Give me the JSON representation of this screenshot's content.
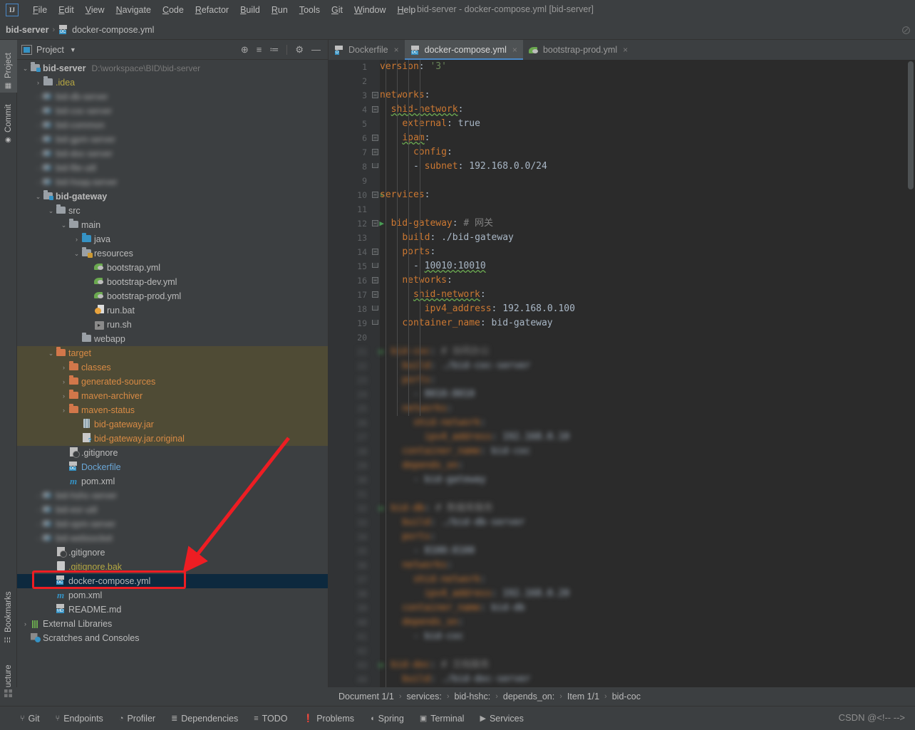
{
  "window": {
    "title": "bid-server - docker-compose.yml [bid-server]"
  },
  "menu": {
    "logo": "IJ",
    "items": [
      "File",
      "Edit",
      "View",
      "Navigate",
      "Code",
      "Refactor",
      "Build",
      "Run",
      "Tools",
      "Git",
      "Window",
      "Help"
    ]
  },
  "navbar": {
    "project": "bid-server",
    "file": "docker-compose.yml"
  },
  "left_strip": {
    "tabs": [
      {
        "label": "Project",
        "icon": "project-icon",
        "active": true
      },
      {
        "label": "Commit",
        "icon": "commit-icon",
        "active": false
      },
      {
        "label": "Bookmarks",
        "icon": "bookmark-icon",
        "active": false
      },
      {
        "label": "Structure",
        "icon": "structure-icon",
        "active": false
      }
    ]
  },
  "project_panel": {
    "title": "Project",
    "tools": [
      {
        "name": "select-opened-file-icon",
        "glyph": "⊕"
      },
      {
        "name": "expand-all-icon",
        "glyph": "≡"
      },
      {
        "name": "collapse-all-icon",
        "glyph": "≔"
      },
      {
        "name": "settings-gear-icon",
        "glyph": "⚙"
      },
      {
        "name": "hide-panel-icon",
        "glyph": "—"
      }
    ],
    "tree": [
      {
        "indent": 0,
        "arrow": "v",
        "icon": "module-folder",
        "label": "bid-server",
        "sub": "D:\\workspace\\BID\\bid-server",
        "bold": true
      },
      {
        "indent": 1,
        "arrow": ">",
        "icon": "folder-grey",
        "label": ".idea",
        "yellow": true
      },
      {
        "indent": 1,
        "arrow": ">",
        "icon": "module",
        "label": "bid-db-server",
        "blur": true
      },
      {
        "indent": 1,
        "arrow": ">",
        "icon": "module",
        "label": "bid-coc-server",
        "blur": true
      },
      {
        "indent": 1,
        "arrow": ">",
        "icon": "module",
        "label": "bid-common",
        "blur": true
      },
      {
        "indent": 1,
        "arrow": ">",
        "icon": "module",
        "label": "bid-gpm-server",
        "blur": true
      },
      {
        "indent": 1,
        "arrow": ">",
        "icon": "module",
        "label": "bid-doc-server",
        "blur": true
      },
      {
        "indent": 1,
        "arrow": ">",
        "icon": "module",
        "label": "bid-file-util",
        "blur": true
      },
      {
        "indent": 1,
        "arrow": ">",
        "icon": "module",
        "label": "bid-hsqq-server",
        "blur": true
      },
      {
        "indent": 1,
        "arrow": "v",
        "icon": "module-folder",
        "label": "bid-gateway",
        "bold": true
      },
      {
        "indent": 2,
        "arrow": "v",
        "icon": "folder-grey",
        "label": "src"
      },
      {
        "indent": 3,
        "arrow": "v",
        "icon": "folder-grey",
        "label": "main"
      },
      {
        "indent": 4,
        "arrow": ">",
        "icon": "folder-src",
        "label": "java"
      },
      {
        "indent": 4,
        "arrow": "v",
        "icon": "folder-res",
        "label": "resources"
      },
      {
        "indent": 5,
        "arrow": "",
        "icon": "yml",
        "label": "bootstrap.yml"
      },
      {
        "indent": 5,
        "arrow": "",
        "icon": "yml",
        "label": "bootstrap-dev.yml"
      },
      {
        "indent": 5,
        "arrow": "",
        "icon": "yml",
        "label": "bootstrap-prod.yml"
      },
      {
        "indent": 5,
        "arrow": "",
        "icon": "bat",
        "label": "run.bat"
      },
      {
        "indent": 5,
        "arrow": "",
        "icon": "sh",
        "label": "run.sh"
      },
      {
        "indent": 4,
        "arrow": "",
        "icon": "folder-grey",
        "label": "webapp"
      },
      {
        "indent": 2,
        "arrow": "v",
        "icon": "folder-orange",
        "label": "target",
        "excluded": true
      },
      {
        "indent": 3,
        "arrow": ">",
        "icon": "folder-orange",
        "label": "classes",
        "excluded": true
      },
      {
        "indent": 3,
        "arrow": ">",
        "icon": "folder-orange",
        "label": "generated-sources",
        "excluded": true
      },
      {
        "indent": 3,
        "arrow": ">",
        "icon": "folder-orange",
        "label": "maven-archiver",
        "excluded": true
      },
      {
        "indent": 3,
        "arrow": ">",
        "icon": "folder-orange",
        "label": "maven-status",
        "excluded": true
      },
      {
        "indent": 4,
        "arrow": "",
        "icon": "jar",
        "label": "bid-gateway.jar",
        "excluded": true
      },
      {
        "indent": 4,
        "arrow": "",
        "icon": "jar-original",
        "label": "bid-gateway.jar.original",
        "excluded": true
      },
      {
        "indent": 3,
        "arrow": "",
        "icon": "gitignore",
        "label": ".gitignore"
      },
      {
        "indent": 3,
        "arrow": "",
        "icon": "docker",
        "label": "Dockerfile",
        "blue": true
      },
      {
        "indent": 3,
        "arrow": "",
        "icon": "maven",
        "label": "pom.xml"
      },
      {
        "indent": 1,
        "arrow": ">",
        "icon": "module",
        "label": "bid-hshc-server",
        "blur": true
      },
      {
        "indent": 1,
        "arrow": ">",
        "icon": "module",
        "label": "bid-esr-util",
        "blur": true
      },
      {
        "indent": 1,
        "arrow": ">",
        "icon": "module",
        "label": "bid-opm-server",
        "blur": true
      },
      {
        "indent": 1,
        "arrow": ">",
        "icon": "module",
        "label": "bid-websocket",
        "blur": true
      },
      {
        "indent": 2,
        "arrow": "",
        "icon": "gitignore",
        "label": ".gitignore"
      },
      {
        "indent": 2,
        "arrow": "",
        "icon": "file",
        "label": ".gitignore.bak",
        "yellow": true
      },
      {
        "indent": 2,
        "arrow": "",
        "icon": "docker",
        "label": "docker-compose.yml",
        "selected": true
      },
      {
        "indent": 2,
        "arrow": "",
        "icon": "maven",
        "label": "pom.xml"
      },
      {
        "indent": 2,
        "arrow": "",
        "icon": "markdown",
        "label": "README.md"
      },
      {
        "indent": 0,
        "arrow": ">",
        "icon": "library",
        "label": "External Libraries"
      },
      {
        "indent": 0,
        "arrow": "",
        "icon": "scratches",
        "label": "Scratches and Consoles"
      }
    ]
  },
  "editor": {
    "tabs": [
      {
        "label": "Dockerfile",
        "icon": "docker-icon",
        "active": false,
        "close": "×"
      },
      {
        "label": "docker-compose.yml",
        "icon": "docker-compose-icon",
        "active": true,
        "close": "×"
      },
      {
        "label": "bootstrap-prod.yml",
        "icon": "yml-icon",
        "active": false,
        "close": "×"
      }
    ],
    "lines": [
      {
        "n": 1,
        "html": "<span class=\"k\">version</span><span class=\"v\">: </span><span class=\"s\">'3'</span>",
        "indent": 0
      },
      {
        "n": 2,
        "html": "",
        "indent": 0
      },
      {
        "n": 3,
        "html": "<span class=\"k\">networks</span><span class=\"v\">:</span>",
        "indent": 0,
        "fold": "minus"
      },
      {
        "n": 4,
        "html": "  <span class=\"k spell\">shid-network</span><span class=\"v\">:</span>",
        "indent": 1,
        "fold": "minus"
      },
      {
        "n": 5,
        "html": "    <span class=\"k\">external</span><span class=\"v\">: true</span>",
        "indent": 2
      },
      {
        "n": 6,
        "html": "    <span class=\"k spell\">ipam</span><span class=\"v\">:</span>",
        "indent": 2,
        "fold": "minus"
      },
      {
        "n": 7,
        "html": "      <span class=\"k\">config</span><span class=\"v\">:</span>",
        "indent": 3,
        "fold": "minus"
      },
      {
        "n": 8,
        "html": "      <span class=\"v\">- </span><span class=\"k\">subnet</span><span class=\"v\">: 192.168.0.0/24</span>",
        "indent": 3,
        "fold": "end"
      },
      {
        "n": 9,
        "html": "",
        "indent": 0
      },
      {
        "n": 10,
        "html": "<span class=\"k\">services</span><span class=\"v\">:</span>",
        "indent": 0,
        "fold": "minus",
        "run": "»"
      },
      {
        "n": 11,
        "html": "",
        "indent": 0
      },
      {
        "n": 12,
        "html": "  <span class=\"k\">bid-gateway</span><span class=\"v\">: </span><span class=\"cm\"># 网关</span>",
        "indent": 1,
        "fold": "minus",
        "run": "▶"
      },
      {
        "n": 13,
        "html": "    <span class=\"k\">build</span><span class=\"v\">: ./bid-gateway</span>",
        "indent": 2
      },
      {
        "n": 14,
        "html": "    <span class=\"k\">ports</span><span class=\"v\">:</span>",
        "indent": 2,
        "fold": "minus"
      },
      {
        "n": 15,
        "html": "      <span class=\"v\">- </span><span class=\"v spell\">10010:10010</span>",
        "indent": 3,
        "fold": "end"
      },
      {
        "n": 16,
        "html": "    <span class=\"k\">networks</span><span class=\"v\">:</span>",
        "indent": 2,
        "fold": "minus"
      },
      {
        "n": 17,
        "html": "      <span class=\"k spell\">shid-network</span><span class=\"v\">:</span>",
        "indent": 3,
        "fold": "minus"
      },
      {
        "n": 18,
        "html": "        <span class=\"k\">ipv4_address</span><span class=\"v\">: 192.168.0.100</span>",
        "indent": 4,
        "fold": "end"
      },
      {
        "n": 19,
        "html": "    <span class=\"k\">container_name</span><span class=\"v\">: bid-gateway</span>",
        "indent": 2,
        "fold": "end"
      },
      {
        "n": 20,
        "html": "",
        "indent": 0
      }
    ],
    "blurred_lines": [
      {
        "n": 21,
        "html": "  <span class=\"k\">bid-coc</span><span class=\"v\">: </span><span class=\"cm\"># 协同办公</span>",
        "run": "▶"
      },
      {
        "n": 22,
        "html": "    <span class=\"k\">build</span><span class=\"v\">: ./bid-coc-server</span>"
      },
      {
        "n": 23,
        "html": "    <span class=\"k\">ports</span><span class=\"v\">:</span>"
      },
      {
        "n": 24,
        "html": "      <span class=\"v\">- 8010:8010</span>"
      },
      {
        "n": 25,
        "html": "    <span class=\"k\">networks</span><span class=\"v\">:</span>"
      },
      {
        "n": 26,
        "html": "      <span class=\"k\">shid-network</span><span class=\"v\">:</span>"
      },
      {
        "n": 27,
        "html": "        <span class=\"k\">ipv4_address</span><span class=\"v\">: 192.168.0.10</span>"
      },
      {
        "n": 28,
        "html": "    <span class=\"k\">container_name</span><span class=\"v\">: bid-coc</span>"
      },
      {
        "n": 29,
        "html": "    <span class=\"k\">depends_on</span><span class=\"v\">:</span>"
      },
      {
        "n": 30,
        "html": "      <span class=\"v\">- bid-gateway</span>"
      },
      {
        "n": 31,
        "html": ""
      },
      {
        "n": 32,
        "html": "  <span class=\"k\">bid-db</span><span class=\"v\">: </span><span class=\"cm\"># 数据库服务</span>",
        "run": "▶"
      },
      {
        "n": 33,
        "html": "    <span class=\"k\">build</span><span class=\"v\">: ./bid-db-server</span>"
      },
      {
        "n": 34,
        "html": "    <span class=\"k\">ports</span><span class=\"v\">:</span>"
      },
      {
        "n": 35,
        "html": "      <span class=\"v\">- 8100:8100</span>"
      },
      {
        "n": 36,
        "html": "    <span class=\"k\">networks</span><span class=\"v\">:</span>"
      },
      {
        "n": 37,
        "html": "      <span class=\"k\">shid-network</span><span class=\"v\">:</span>"
      },
      {
        "n": 38,
        "html": "        <span class=\"k\">ipv4_address</span><span class=\"v\">: 192.168.0.20</span>"
      },
      {
        "n": 39,
        "html": "    <span class=\"k\">container_name</span><span class=\"v\">: bid-db</span>"
      },
      {
        "n": 40,
        "html": "    <span class=\"k\">depends_on</span><span class=\"v\">:</span>"
      },
      {
        "n": 41,
        "html": "      <span class=\"v\">- bid-coc</span>"
      },
      {
        "n": 42,
        "html": ""
      },
      {
        "n": 43,
        "html": "  <span class=\"k\">bid-doc</span><span class=\"v\">: </span><span class=\"cm\"># 文档服务</span>",
        "run": "▶"
      },
      {
        "n": 44,
        "html": "    <span class=\"k\">build</span><span class=\"v\">: ./bid-doc-server</span>"
      }
    ]
  },
  "status_bar": {
    "breadcrumb": [
      "Document 1/1",
      "services:",
      "bid-hshc:",
      "depends_on:",
      "Item 1/1",
      "bid-coc"
    ],
    "separator": "›"
  },
  "bottom_bar": {
    "buttons": [
      {
        "label": "Git",
        "icon": "git-icon",
        "glyph": "⑂"
      },
      {
        "label": "Endpoints",
        "icon": "endpoints-icon",
        "glyph": "⑂"
      },
      {
        "label": "Profiler",
        "icon": "profiler-icon",
        "glyph": "◔"
      },
      {
        "label": "Dependencies",
        "icon": "dependencies-icon",
        "glyph": "≣"
      },
      {
        "label": "TODO",
        "icon": "todo-icon",
        "glyph": "≡"
      },
      {
        "label": "Problems",
        "icon": "problems-icon",
        "glyph": "❗"
      },
      {
        "label": "Spring",
        "icon": "spring-icon",
        "glyph": "◖"
      },
      {
        "label": "Terminal",
        "icon": "terminal-icon",
        "glyph": "▣"
      },
      {
        "label": "Services",
        "icon": "services-icon",
        "glyph": "▶"
      }
    ]
  },
  "watermark": {
    "text": "CSDN @<!-- -->"
  },
  "colors": {
    "accent": "#4a88c7",
    "panel_bg": "#3c3f41",
    "editor_bg": "#2b2b2b",
    "gutter_bg": "#313335",
    "selection": "#0d293e",
    "excluded": "#4f4b35",
    "key_orange": "#cc7832",
    "string_green": "#6a8759",
    "annotation_red": "#ee1d23"
  }
}
